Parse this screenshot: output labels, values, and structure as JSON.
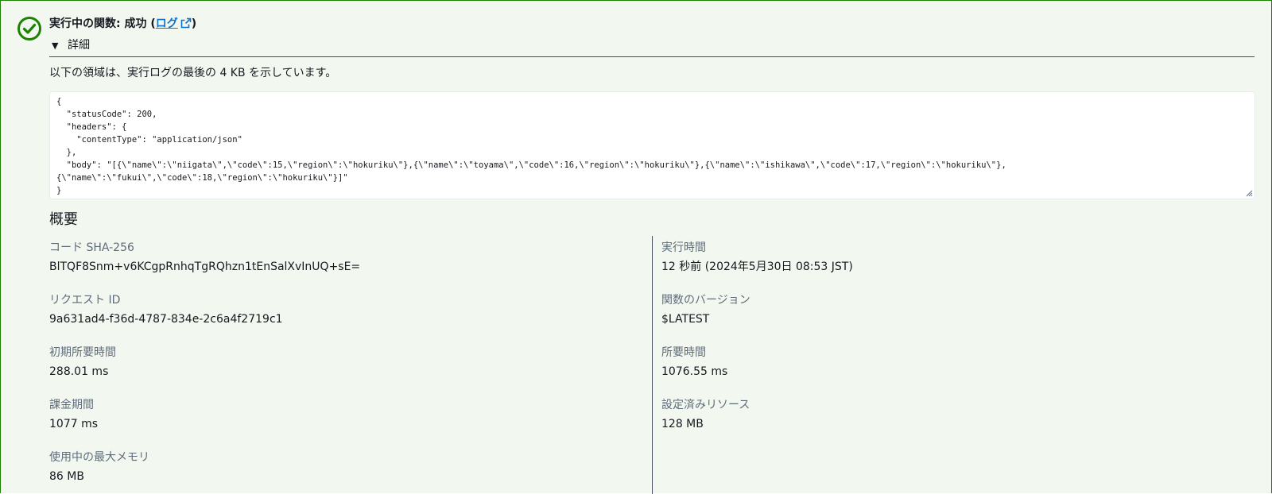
{
  "header": {
    "status_text": "実行中の関数: 成功",
    "paren_open": "(",
    "log_link": "ログ",
    "paren_close": ")"
  },
  "details": {
    "toggle_label": "詳細",
    "info_text": "以下の領域は、実行ログの最後の 4 KB を示しています。"
  },
  "log_output": {
    "lines": [
      "{",
      "  \"statusCode\": 200,",
      "  \"headers\": {",
      "    \"contentType\": \"application/json\"",
      "  },",
      "  \"body\": \"[{\\\"name\\\":\\\"niigata\\\",\\\"code\\\":15,\\\"region\\\":\\\"hokuriku\\\"},{\\\"name\\\":\\\"toyama\\\",\\\"code\\\":16,\\\"region\\\":\\\"hokuriku\\\"},{\\\"name\\\":\\\"ishikawa\\\",\\\"code\\\":17,\\\"region\\\":\\\"hokuriku\\\"},",
      "{\\\"name\\\":\\\"fukui\\\",\\\"code\\\":18,\\\"region\\\":\\\"hokuriku\\\"}]\"",
      "}"
    ]
  },
  "summary": {
    "title": "概要",
    "left": [
      {
        "label": "コード SHA-256",
        "value": "BlTQF8Snm+v6KCgpRnhqTgRQhzn1tEnSalXvInUQ+sE="
      },
      {
        "label": "リクエスト ID",
        "value": "9a631ad4-f36d-4787-834e-2c6a4f2719c1"
      },
      {
        "label": "初期所要時間",
        "value": "288.01 ms"
      },
      {
        "label": "課金期間",
        "value": "1077 ms"
      },
      {
        "label": "使用中の最大メモリ",
        "value": "86 MB"
      }
    ],
    "right": [
      {
        "label": "実行時間",
        "value": "12 秒前 (2024年5月30日 08:53 JST)"
      },
      {
        "label": "関数のバージョン",
        "value": "$LATEST"
      },
      {
        "label": "所要時間",
        "value": "1076.55 ms"
      },
      {
        "label": "設定済みリソース",
        "value": "128 MB"
      }
    ]
  },
  "colors": {
    "success": "#1d8102",
    "alert_bg": "#f2f8f0",
    "link": "#0972d3"
  },
  "icons": {
    "status": "success-check-circle-icon",
    "external": "external-link-icon",
    "toggle": "caret-down-icon"
  }
}
